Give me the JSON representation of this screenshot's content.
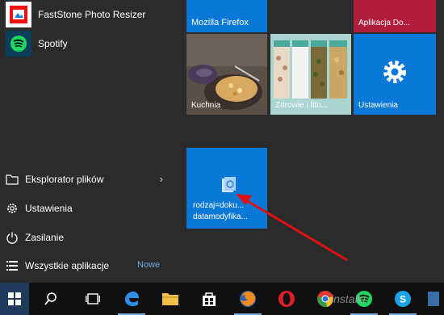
{
  "apps": [
    {
      "label": "FastStone Photo Resizer",
      "icon": "faststone-icon"
    },
    {
      "label": "Spotify",
      "icon": "spotify-icon"
    }
  ],
  "nav": {
    "explorer": "Eksplorator plików",
    "settings": "Ustawienia",
    "power": "Zasilanie",
    "all_apps": "Wszystkie aplikacje",
    "new_badge": "Nowe"
  },
  "tiles": {
    "firefox": "Mozilla Firefox",
    "aplikacja": "Aplikacja Do...",
    "kuchnia": "Kuchnia",
    "zdrowie": "Zdrowie i fitn...",
    "ustawienia": "Ustawienia",
    "search": "rodzaj=doku...",
    "search_line2": "datamodyfika..."
  },
  "taskbar": {
    "watermark": "instalki"
  },
  "colors": {
    "tile_blue": "#0a78d7",
    "tile_red": "#b01e3c",
    "bg": "#2b2b2b",
    "taskbar": "#101010"
  }
}
